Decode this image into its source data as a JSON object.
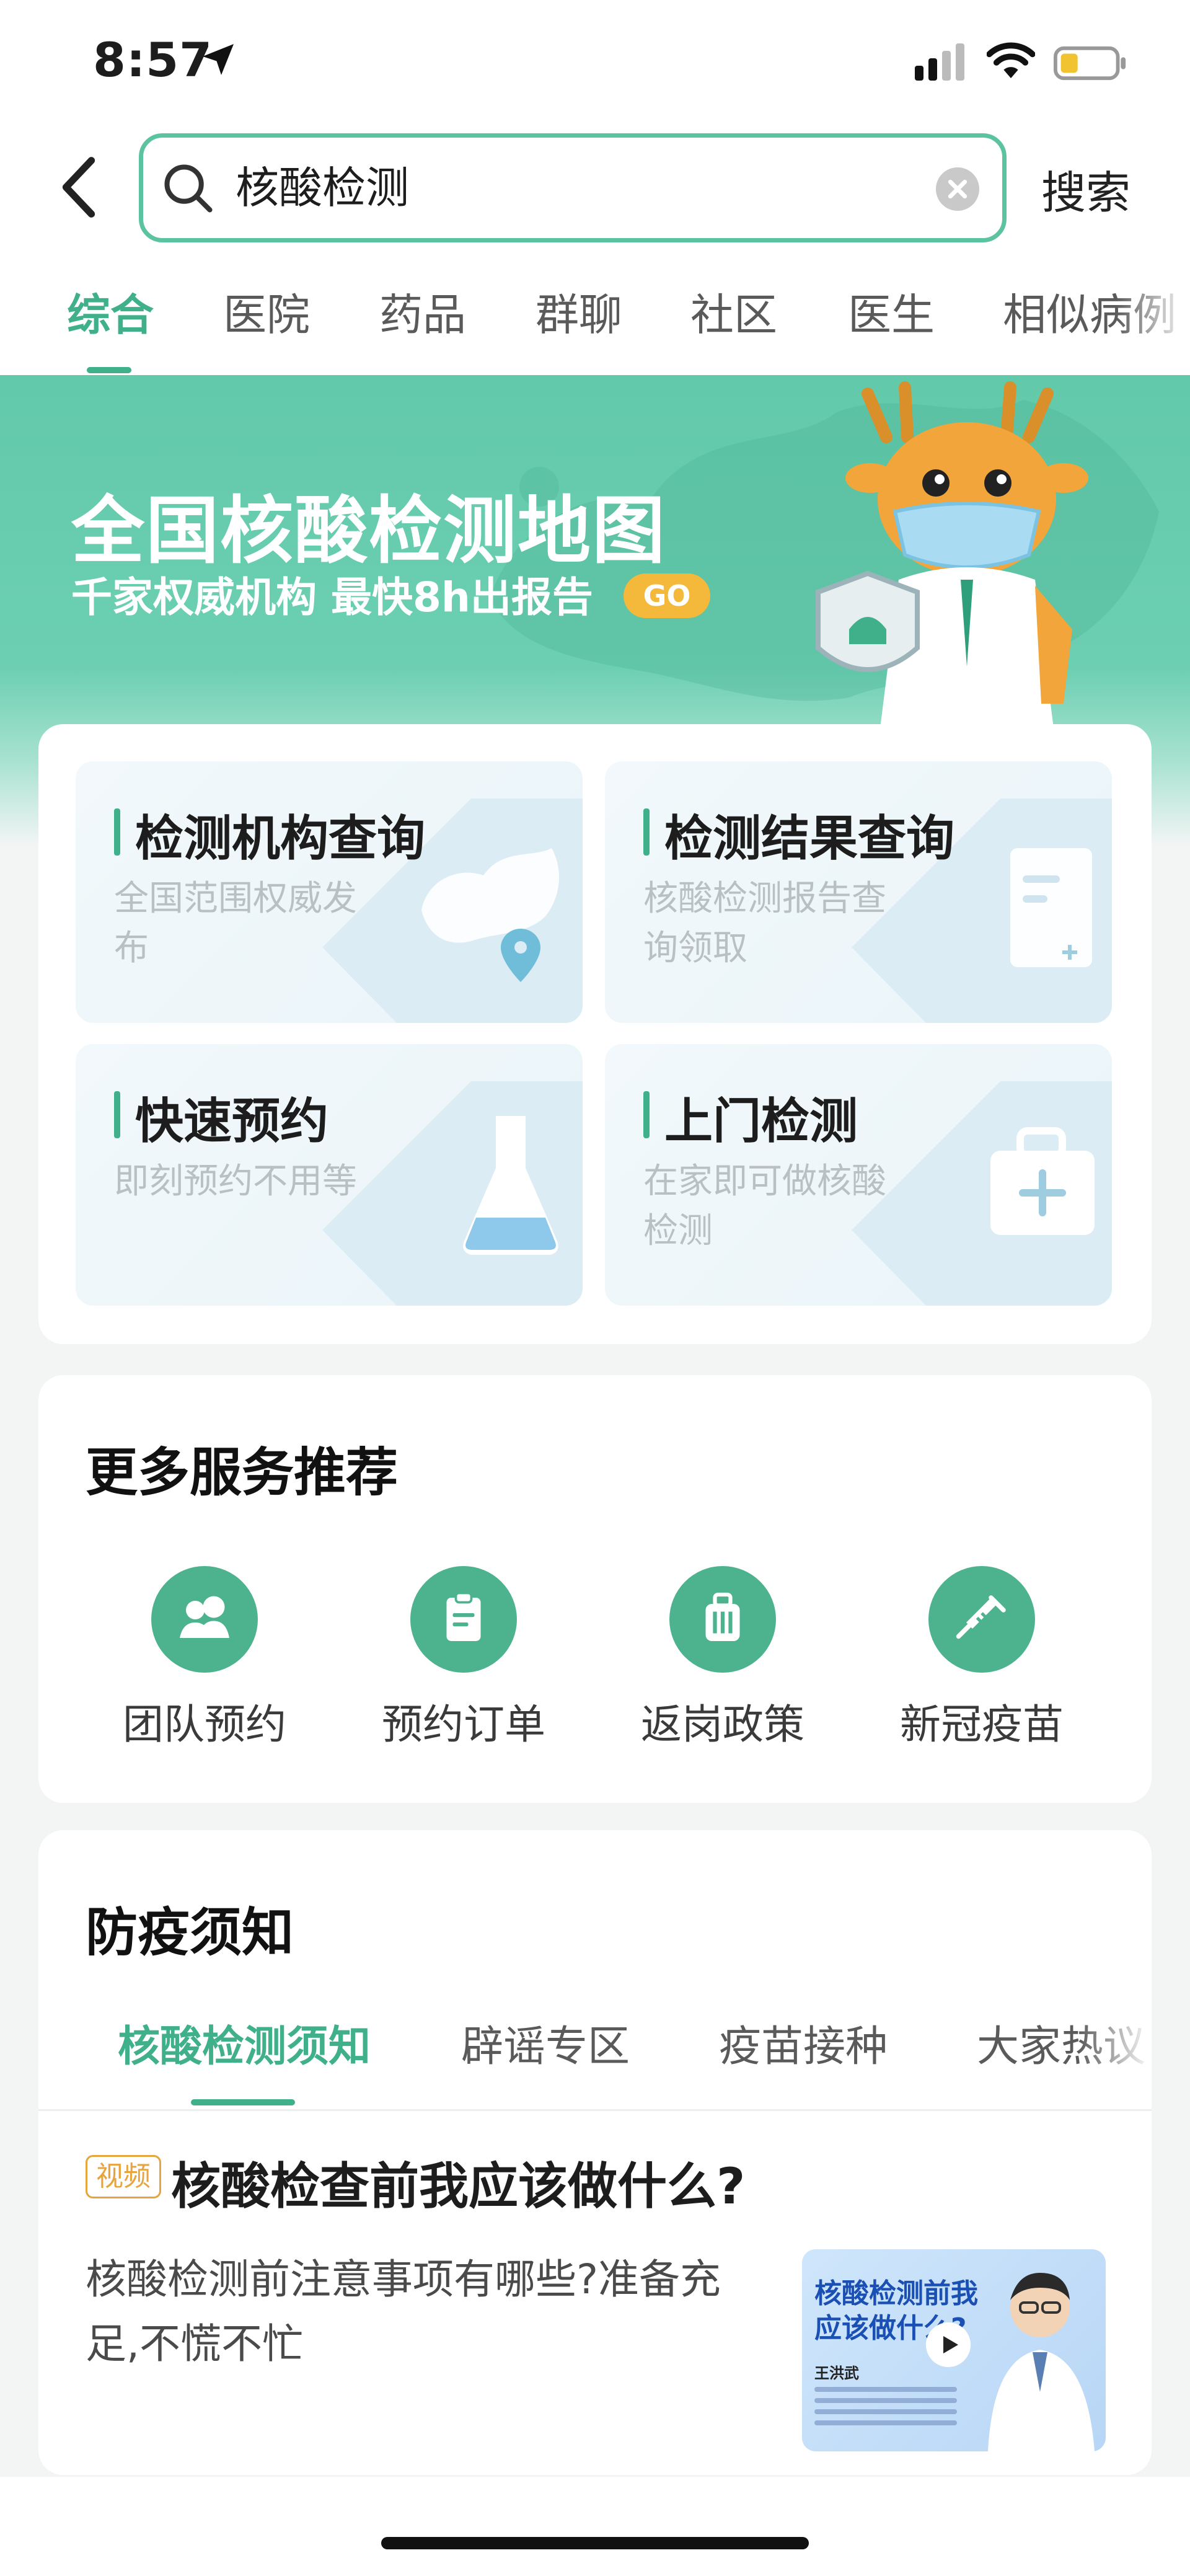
{
  "status_bar": {
    "time": "8:57"
  },
  "search": {
    "query": "核酸检测",
    "button_label": "搜索"
  },
  "tabs": [
    {
      "label": "综合"
    },
    {
      "label": "医院"
    },
    {
      "label": "药品"
    },
    {
      "label": "群聊"
    },
    {
      "label": "社区"
    },
    {
      "label": "医生"
    },
    {
      "label": "相似病例"
    }
  ],
  "banner": {
    "title": "全国核酸检测地图",
    "subtitle": "千家权威机构 最快8h出报告",
    "go_label": "GO"
  },
  "services": [
    {
      "title": "检测机构查询",
      "desc": "全国范围权威发布"
    },
    {
      "title": "检测结果查询",
      "desc": "核酸检测报告查询领取"
    },
    {
      "title": "快速预约",
      "desc": "即刻预约不用等"
    },
    {
      "title": "上门检测",
      "desc": "在家即可做核酸检测"
    }
  ],
  "more_services": {
    "title": "更多服务推荐",
    "items": [
      {
        "label": "团队预约",
        "icon": "team-icon"
      },
      {
        "label": "预约订单",
        "icon": "order-icon"
      },
      {
        "label": "返岗政策",
        "icon": "luggage-icon"
      },
      {
        "label": "新冠疫苗",
        "icon": "syringe-icon"
      }
    ]
  },
  "notice": {
    "title": "防疫须知",
    "subtabs": [
      {
        "label": "核酸检测须知"
      },
      {
        "label": "辟谣专区"
      },
      {
        "label": "疫苗接种"
      },
      {
        "label": "大家热议"
      }
    ],
    "article": {
      "badge": "视频",
      "title": "核酸检查前我应该做什么?",
      "summary": "核酸检测前注意事项有哪些?准备充足,不慌不忙",
      "thumb_title": "核酸检测前我应该做什么?",
      "thumb_name": "王洪武"
    }
  },
  "colors": {
    "accent": "#3fb08a",
    "banner": "#62c9aa",
    "badge": "#e7a33c"
  }
}
